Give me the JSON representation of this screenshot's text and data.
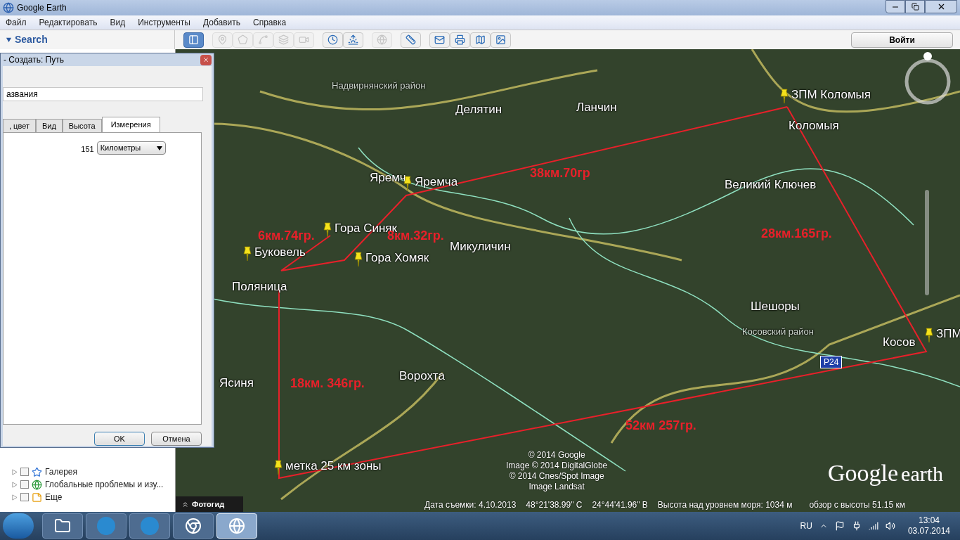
{
  "window": {
    "title": "Google Earth"
  },
  "menu": [
    "Файл",
    "Редактировать",
    "Вид",
    "Инструменты",
    "Добавить",
    "Справка"
  ],
  "search_panel": {
    "title": "Search",
    "expanded": true
  },
  "toolbar": [
    {
      "selected": true,
      "disabled": false
    },
    {
      "selected": false,
      "disabled": true
    },
    {
      "selected": false,
      "disabled": true
    },
    {
      "selected": false,
      "disabled": true
    },
    {
      "selected": false,
      "disabled": true
    },
    {
      "selected": false,
      "disabled": true
    },
    {
      "selected": false,
      "disabled": false
    },
    {
      "selected": false,
      "disabled": false
    },
    {
      "selected": false,
      "disabled": true
    },
    {
      "selected": false,
      "disabled": false
    },
    {
      "selected": false,
      "disabled": false
    },
    {
      "selected": false,
      "disabled": false
    },
    {
      "selected": false,
      "disabled": false
    },
    {
      "selected": false,
      "disabled": false
    }
  ],
  "sign_in_button": "Войти",
  "dialog": {
    "title": "- Создать: Путь",
    "name_field": "азвания",
    "tabs": [
      {
        "label": ", цвет",
        "selected": false
      },
      {
        "label": "Вид",
        "selected": false
      },
      {
        "label": "Высота",
        "selected": false
      },
      {
        "label": "Измерения",
        "selected": true
      }
    ],
    "length": "151",
    "unit": "Километры",
    "buttons": [
      "OK",
      "Отмена"
    ]
  },
  "layers": [
    {
      "label": "Галерея",
      "checked": false
    },
    {
      "label": "Глобальные проблемы и изу...",
      "checked": false
    },
    {
      "label": "Еще",
      "checked": false
    }
  ],
  "map": {
    "labels": [
      {
        "label": "Надвирнянский район",
        "kind": "district"
      },
      {
        "label": "Делятин",
        "kind": "town"
      },
      {
        "label": "Ланчин",
        "kind": "town"
      },
      {
        "label": "ЗПМ Коломыя",
        "kind": "pin"
      },
      {
        "label": "Коломыя",
        "kind": "town"
      },
      {
        "label": "Яремч",
        "kind": "town"
      },
      {
        "label": "Яремча",
        "kind": "pin"
      },
      {
        "label": "38км.70гр",
        "kind": "measure"
      },
      {
        "label": "Великий Ключев",
        "kind": "town"
      },
      {
        "label": "6км.74гр.",
        "kind": "measure"
      },
      {
        "label": "Гора Синяк",
        "kind": "pin"
      },
      {
        "label": "8км.32гр.",
        "kind": "measure"
      },
      {
        "label": "28км.165гр.",
        "kind": "measure"
      },
      {
        "label": "Буковель",
        "kind": "pin"
      },
      {
        "label": "Гора Хомяк",
        "kind": "pin"
      },
      {
        "label": "Микуличин",
        "kind": "town"
      },
      {
        "label": "Поляница",
        "kind": "town"
      },
      {
        "label": "Шешоры",
        "kind": "town"
      },
      {
        "label": "Косовский район",
        "kind": "district"
      },
      {
        "label": "Косов",
        "kind": "town"
      },
      {
        "label": "ЗПМ",
        "kind": "pin"
      },
      {
        "label": "P24",
        "kind": "road"
      },
      {
        "label": "Ясиня",
        "kind": "town"
      },
      {
        "label": "18км. 346гр.",
        "kind": "measure"
      },
      {
        "label": "Ворохта",
        "kind": "town"
      },
      {
        "label": "52км 257гр.",
        "kind": "measure"
      },
      {
        "label": "метка 25 км зоны",
        "kind": "pin"
      }
    ],
    "photo_guide": "Фотогид",
    "copyright": [
      "© 2014 Google",
      "Image © 2014 DigitalGlobe",
      "© 2014 Cnes/Spot Image",
      "Image Landsat"
    ],
    "logo": {
      "word_1": "Google",
      "word_2": "earth"
    }
  },
  "status_bar": [
    "Дата съемки: 4.10.2013",
    "48°21'38.99\" С",
    "24°44'41.96\" В",
    "Высота над уровнем моря:  1034 м",
    "обзор с высоты  51.15 км"
  ],
  "taskbar": {
    "apps": [
      {
        "selected": false
      },
      {
        "selected": false
      },
      {
        "selected": false
      },
      {
        "selected": false
      },
      {
        "selected": true
      }
    ],
    "language": "RU",
    "time": "13:04",
    "date": "03.07.2014"
  }
}
